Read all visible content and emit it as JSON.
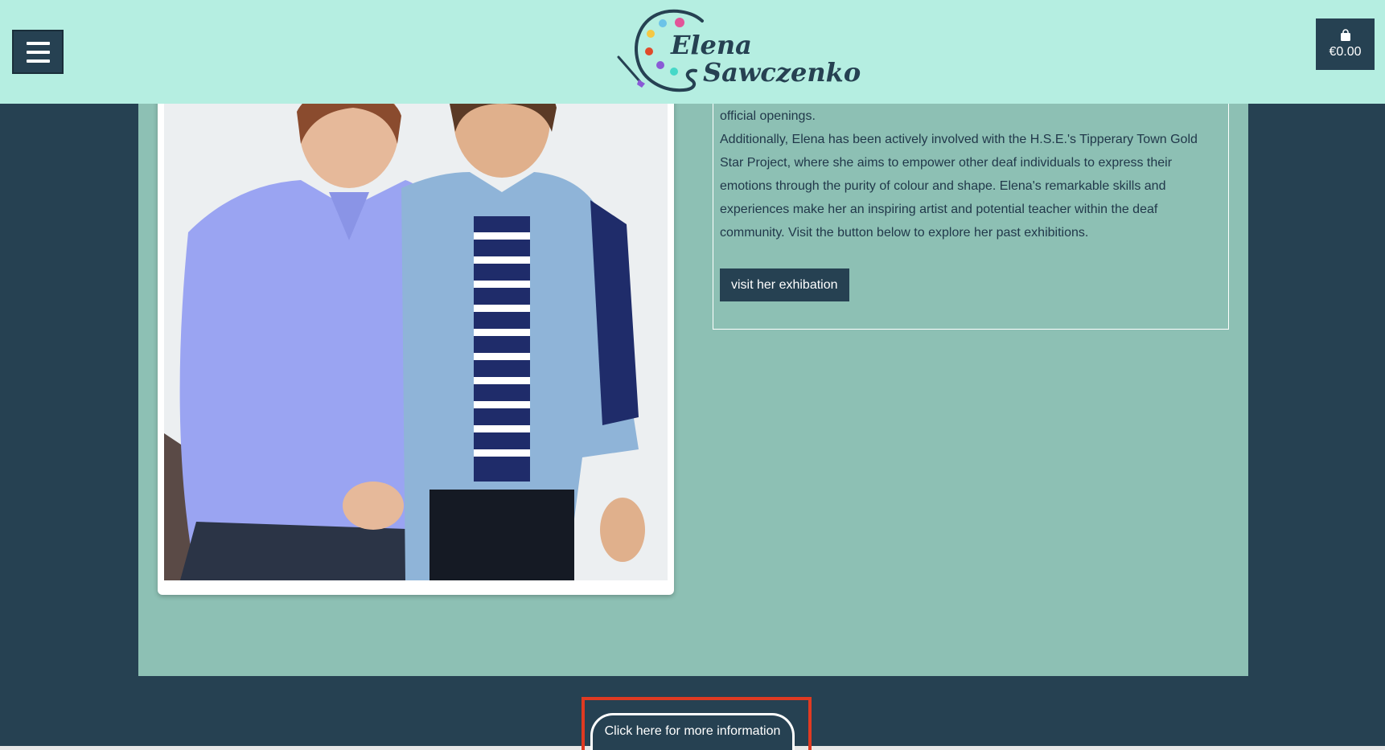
{
  "header": {
    "logo_first": "Elena",
    "logo_last": "Sawczenko",
    "cart_amount": "€0.00",
    "icons": [
      "menu-icon",
      "palette-logo-icon",
      "shopping-bag-icon"
    ]
  },
  "main": {
    "para1": "official openings.",
    "para2": "Additionally, Elena has been actively involved with the H.S.E.'s Tipperary Town Gold Star Project, where she aims to empower other deaf individuals to express their emotions through the purity of colour and shape. Elena's remarkable skills and experiences make her an inspiring artist and potential teacher within the deaf community. Visit the button below to explore her past exhibitions.",
    "visit_button": "visit her exhibation"
  },
  "footer": {
    "info_button": "Click here for more information"
  },
  "colors": {
    "header_bg": "#b5eee1",
    "page_bg": "#264152",
    "content_bg": "#8dc0b4",
    "highlight": "#e03a22"
  }
}
